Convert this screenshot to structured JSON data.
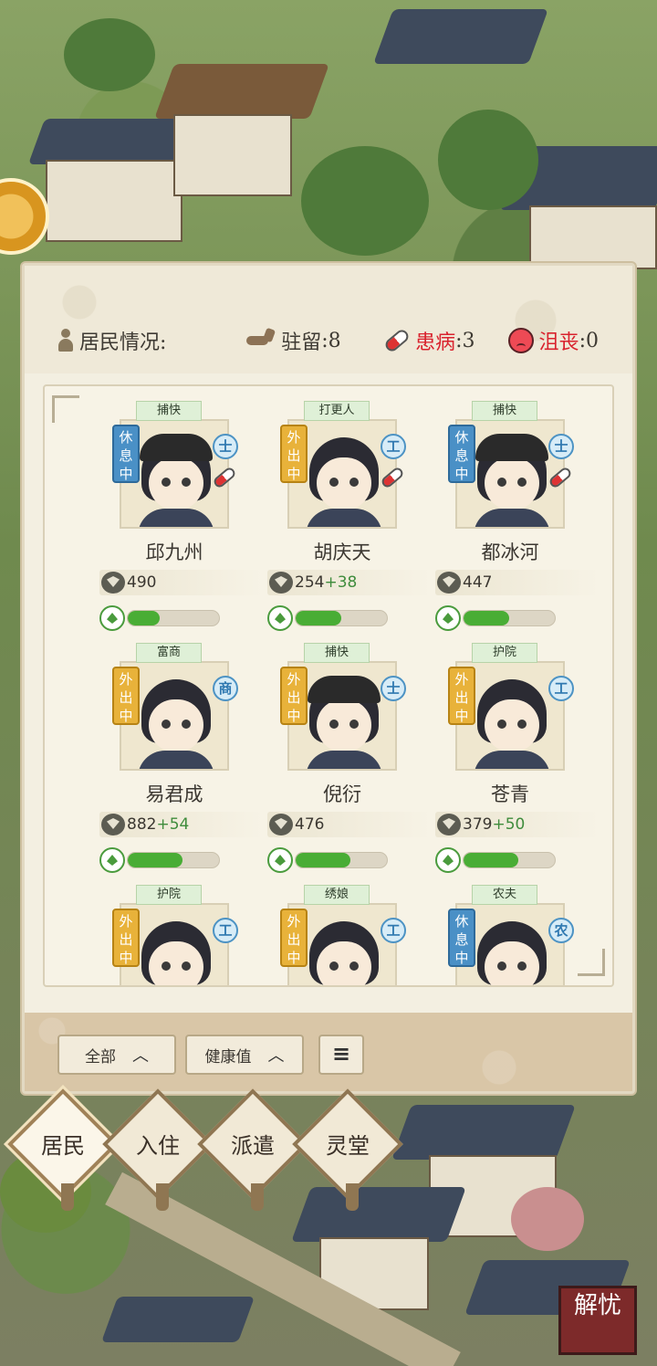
{
  "header": {
    "resident_label": "居民情况:",
    "stationed_label": "驻留",
    "stationed_value": ":8",
    "sick_label": "患病",
    "sick_value": ":3",
    "depressed_label": "沮丧",
    "depressed_value": ":0"
  },
  "residents": [
    {
      "role": "捕快",
      "status": "休息中",
      "status_type": "rest",
      "class": "士",
      "sick": true,
      "name": "邱九州",
      "vitality": "490",
      "bonus": "",
      "hp": 0.35
    },
    {
      "role": "打更人",
      "status": "外出中",
      "status_type": "out",
      "class": "工",
      "sick": true,
      "name": "胡庆天",
      "vitality": "254",
      "bonus": "+38",
      "hp": 0.5
    },
    {
      "role": "捕快",
      "status": "休息中",
      "status_type": "rest",
      "class": "士",
      "sick": true,
      "name": "都冰河",
      "vitality": "447",
      "bonus": "",
      "hp": 0.5
    },
    {
      "role": "富商",
      "status": "外出中",
      "status_type": "out",
      "class": "商",
      "sick": false,
      "name": "易君成",
      "vitality": "882",
      "bonus": "+54",
      "hp": 0.6
    },
    {
      "role": "捕快",
      "status": "外出中",
      "status_type": "out",
      "class": "士",
      "sick": false,
      "name": "倪衍",
      "vitality": "476",
      "bonus": "",
      "hp": 0.6
    },
    {
      "role": "护院",
      "status": "外出中",
      "status_type": "out",
      "class": "工",
      "sick": false,
      "name": "苍青",
      "vitality": "379",
      "bonus": "+50",
      "hp": 0.6
    },
    {
      "role": "护院",
      "status": "外出中",
      "status_type": "out",
      "class": "工",
      "sick": false,
      "name": "",
      "vitality": "",
      "bonus": "",
      "hp": 0
    },
    {
      "role": "绣娘",
      "status": "外出中",
      "status_type": "out",
      "class": "工",
      "sick": false,
      "name": "",
      "vitality": "",
      "bonus": "",
      "hp": 0
    },
    {
      "role": "农夫",
      "status": "休息中",
      "status_type": "rest",
      "class": "农",
      "sick": false,
      "name": "",
      "vitality": "",
      "bonus": "",
      "hp": 0
    }
  ],
  "filters": {
    "all_label": "全部",
    "health_label": "健康值",
    "sort_icon": "≡"
  },
  "tabs": [
    {
      "label": "居民",
      "active": true
    },
    {
      "label": "入住",
      "active": false
    },
    {
      "label": "派遣",
      "active": false
    },
    {
      "label": "灵堂",
      "active": false
    }
  ],
  "seal_text": "解忧"
}
